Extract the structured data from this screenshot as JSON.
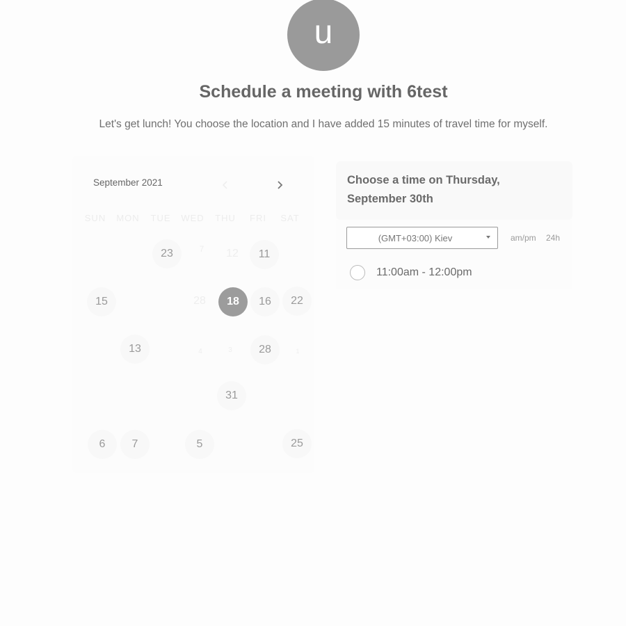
{
  "avatar": {
    "initial": "u"
  },
  "title": "Schedule a meeting with 6test",
  "description": "Let's get lunch! You choose the location and I have added 15 minutes of travel time for myself.",
  "calendar": {
    "month": "September 2021",
    "prev_icon": "chevron-left-icon",
    "next_icon": "chevron-right-icon",
    "weekdays": [
      "SUN",
      "MON",
      "TUE",
      "WED",
      "THU",
      "FRI",
      "SAT"
    ],
    "days": {
      "d23": "23",
      "d7a": "7",
      "d12": "12",
      "d11": "11",
      "d15": "15",
      "d28a": "28",
      "d18": "18",
      "d16": "16",
      "d22": "22",
      "d13": "13",
      "d4": "4",
      "d3": "3",
      "d28b": "28",
      "d1": "1",
      "d31": "31",
      "d6": "6",
      "d7b": "7",
      "d5": "5",
      "d25": "25"
    },
    "selected_day": "18"
  },
  "time_panel": {
    "heading": "Choose a time on Thursday, September 30th",
    "timezone": "(GMT+03:00) Kiev",
    "format_ampm": "am/pm",
    "format_24h": "24h",
    "slots": [
      "11:00am - 12:00pm"
    ]
  },
  "colors": {
    "selected_day_bg": "#9c9c9c",
    "avatar_bg": "#9a9a9a",
    "text": "#666666"
  }
}
